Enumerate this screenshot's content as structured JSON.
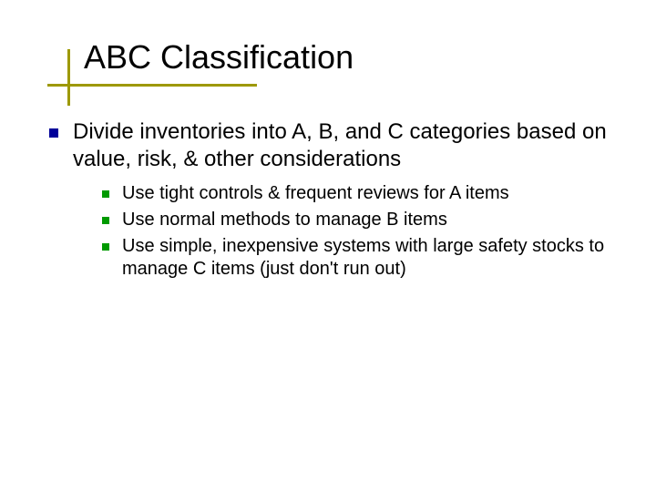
{
  "title": "ABC Classification",
  "main_point": "Divide inventories into A, B, and C categories based on value, risk, & other considerations",
  "sub_points": {
    "0": "Use tight controls & frequent reviews for A items",
    "1": "Use normal methods to manage B items",
    "2": "Use simple, inexpensive systems with large safety stocks to manage C items (just don't run out)"
  }
}
